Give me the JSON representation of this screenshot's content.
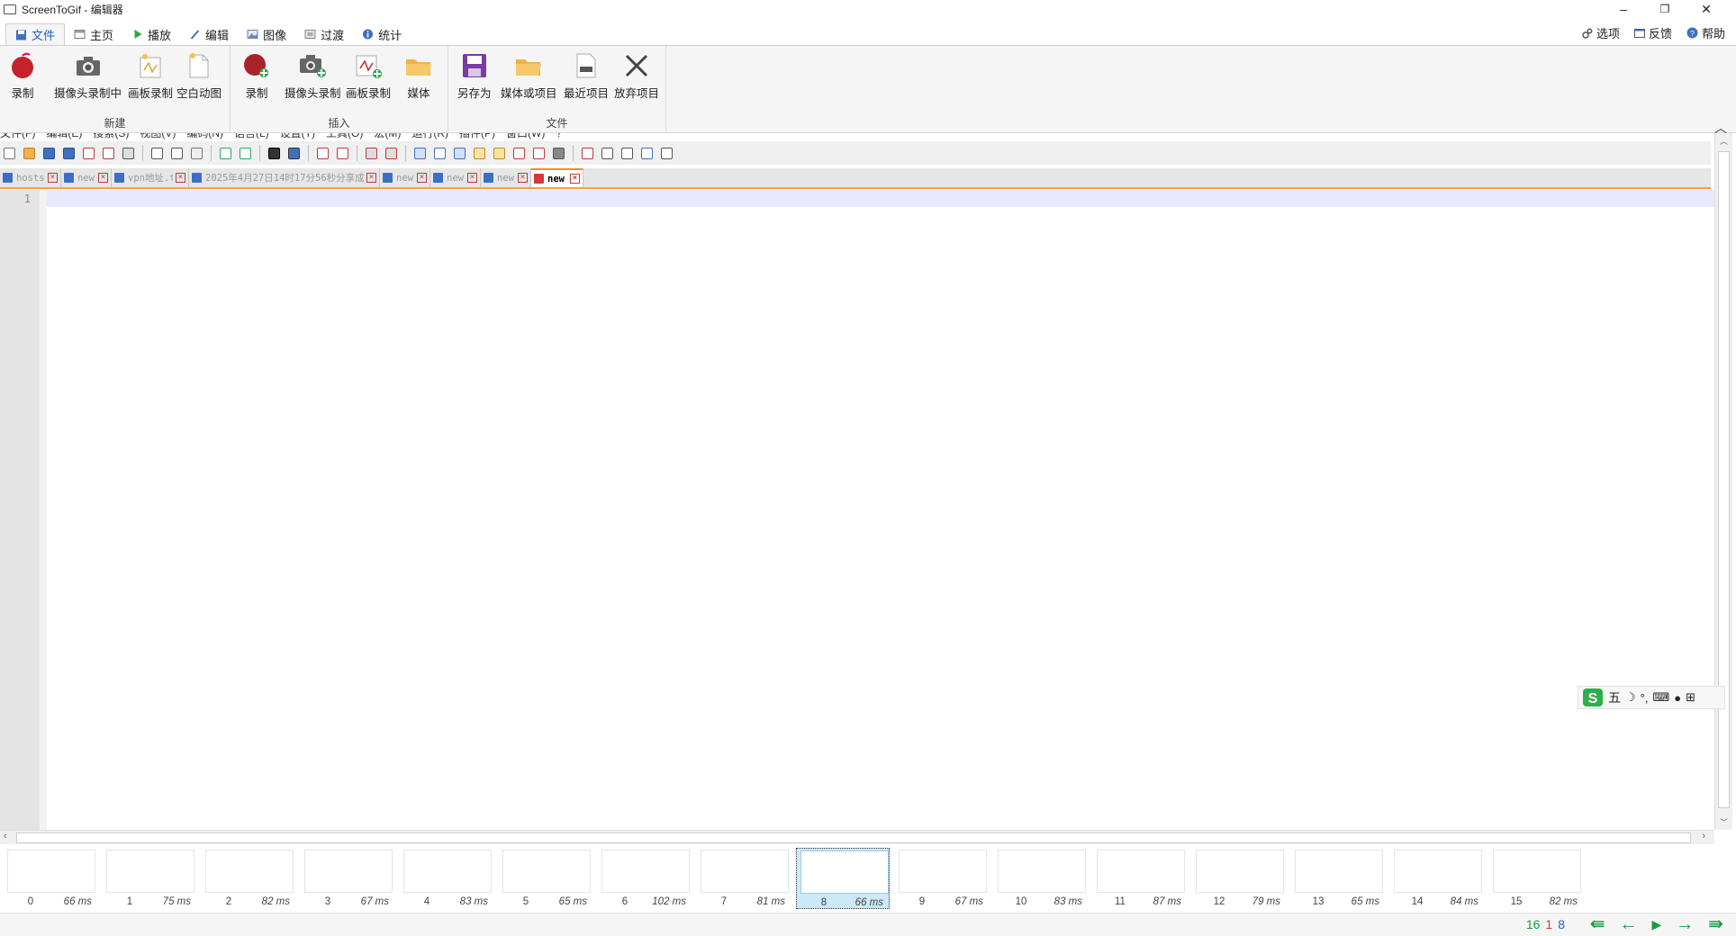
{
  "window": {
    "title": "ScreenToGif - 编辑器",
    "minimize": "–",
    "restore": "❐",
    "close": "✕"
  },
  "ribbon_tabs": [
    {
      "label": "文件",
      "active": true
    },
    {
      "label": "主页"
    },
    {
      "label": "播放"
    },
    {
      "label": "编辑"
    },
    {
      "label": "图像"
    },
    {
      "label": "过渡"
    },
    {
      "label": "统计"
    }
  ],
  "top_links": {
    "options": "选项",
    "feedback": "反馈",
    "help": "帮助"
  },
  "ribbon": {
    "groups": [
      {
        "label": "新建",
        "buttons": [
          "录制",
          "摄像头录制中",
          "画板录制",
          "空白动图"
        ]
      },
      {
        "label": "插入",
        "buttons": [
          "录制",
          "摄像头录制",
          "画板录制",
          "媒体"
        ]
      },
      {
        "label": "文件",
        "buttons": [
          "另存为",
          "媒体或项目",
          "最近项目",
          "放弃项目"
        ]
      }
    ]
  },
  "npp_menu": [
    "文件(F)",
    "编辑(E)",
    "搜索(S)",
    "视图(V)",
    "编码(N)",
    "语言(L)",
    "设置(T)",
    "工具(O)",
    "宏(M)",
    "运行(R)",
    "插件(P)",
    "窗口(W)",
    "?"
  ],
  "doc_tabs": [
    {
      "label": "hosts"
    },
    {
      "label": "new 5"
    },
    {
      "label": "vpn地址.txt"
    },
    {
      "label": "2025年4月27日14时17分56秒分享成功.txt"
    },
    {
      "label": "new 1"
    },
    {
      "label": "new 2"
    },
    {
      "label": "new 3"
    },
    {
      "label": "new 4",
      "active": true
    }
  ],
  "editor": {
    "line_number": "1"
  },
  "ime": {
    "mode": "五"
  },
  "frames": [
    {
      "num": "0",
      "ms": "66 ms"
    },
    {
      "num": "1",
      "ms": "75 ms"
    },
    {
      "num": "2",
      "ms": "82 ms"
    },
    {
      "num": "3",
      "ms": "67 ms"
    },
    {
      "num": "4",
      "ms": "83 ms"
    },
    {
      "num": "5",
      "ms": "65 ms"
    },
    {
      "num": "6",
      "ms": "102 ms"
    },
    {
      "num": "7",
      "ms": "81 ms"
    },
    {
      "num": "8",
      "ms": "66 ms",
      "selected": true
    },
    {
      "num": "9",
      "ms": "67 ms"
    },
    {
      "num": "10",
      "ms": "83 ms"
    },
    {
      "num": "11",
      "ms": "87 ms"
    },
    {
      "num": "12",
      "ms": "79 ms"
    },
    {
      "num": "13",
      "ms": "65 ms"
    },
    {
      "num": "14",
      "ms": "84 ms"
    },
    {
      "num": "15",
      "ms": "82 ms"
    }
  ],
  "status": {
    "total": "16",
    "selected": "1",
    "current": "8"
  },
  "colors": {
    "accent": "#1e63c7",
    "total_color": "#1a9a45",
    "selected_color": "#d23b3b",
    "current_color": "#1e63c7",
    "nav_color": "#1a9a45",
    "tab_highlight": "#ff8a1c"
  }
}
